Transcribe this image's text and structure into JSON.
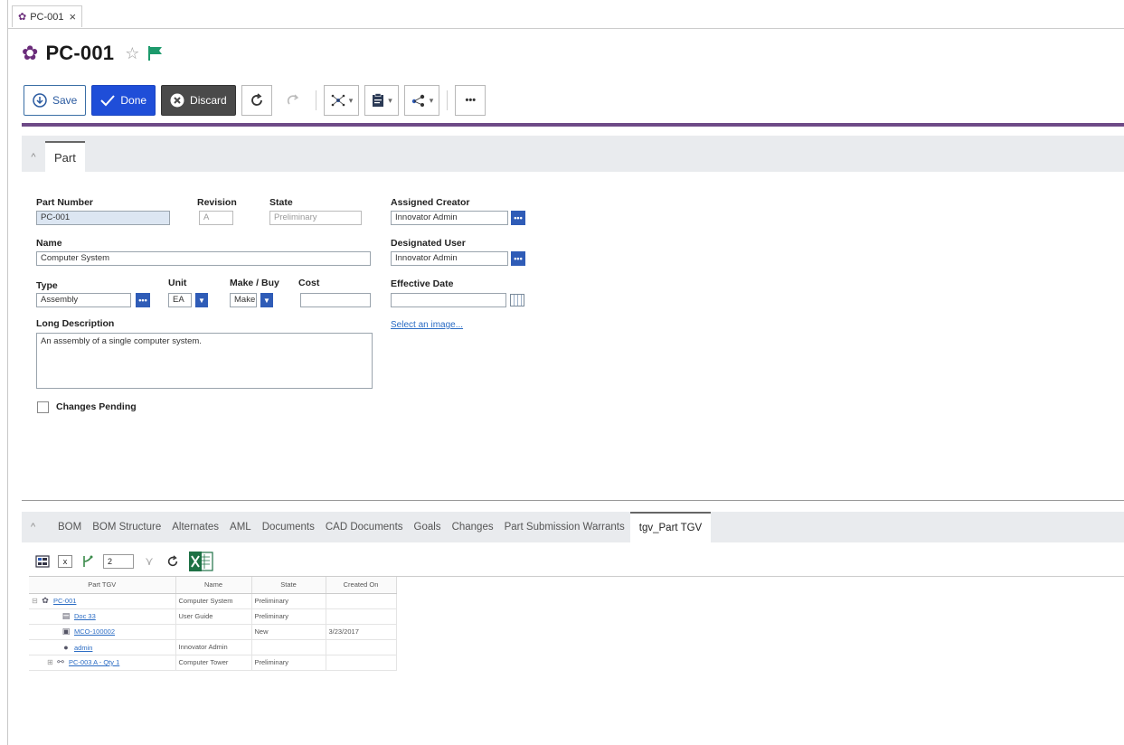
{
  "tab": {
    "label": "PC-001",
    "close": "×"
  },
  "header": {
    "title": "PC-001",
    "star": "☆"
  },
  "toolbar": {
    "save": "Save",
    "done": "Done",
    "discard": "Discard",
    "more": "•••"
  },
  "section": {
    "toggle": "^",
    "tab_label": "Part"
  },
  "form": {
    "part_number": {
      "label": "Part Number",
      "value": "PC-001"
    },
    "revision": {
      "label": "Revision",
      "value": "A"
    },
    "state": {
      "label": "State",
      "value": "Preliminary"
    },
    "assigned_creator": {
      "label": "Assigned Creator",
      "value": "Innovator Admin"
    },
    "name": {
      "label": "Name",
      "value": "Computer System"
    },
    "designated_user": {
      "label": "Designated User",
      "value": "Innovator Admin"
    },
    "type": {
      "label": "Type",
      "value": "Assembly"
    },
    "unit": {
      "label": "Unit",
      "value": "EA"
    },
    "make_buy": {
      "label": "Make / Buy",
      "value": "Make"
    },
    "cost": {
      "label": "Cost",
      "value": ""
    },
    "effective_date": {
      "label": "Effective Date",
      "value": ""
    },
    "long_description": {
      "label": "Long Description",
      "value": "An assembly of a single computer system."
    },
    "select_image": "Select an image...",
    "changes_pending": "Changes Pending"
  },
  "relationships": {
    "toggle": "^",
    "tabs": [
      "BOM",
      "BOM Structure",
      "Alternates",
      "AML",
      "Documents",
      "CAD Documents",
      "Goals",
      "Changes",
      "Part Submission Warrants",
      "tgv_Part TGV"
    ],
    "active": "tgv_Part TGV",
    "level_value": "2"
  },
  "grid": {
    "columns": [
      "Part TGV",
      "Name",
      "State",
      "Created On"
    ],
    "rows": [
      {
        "id": "PC-001",
        "name": "Computer System",
        "state": "Preliminary",
        "created": ""
      },
      {
        "id": "Doc 33",
        "name": "User Guide",
        "state": "Preliminary",
        "created": ""
      },
      {
        "id": "MCO-100002",
        "name": "",
        "state": "New",
        "created": "3/23/2017"
      },
      {
        "id": "admin",
        "name": "Innovator Admin",
        "state": "",
        "created": ""
      },
      {
        "id": "PC-003 A - Qty 1",
        "name": "Computer Tower",
        "state": "Preliminary",
        "created": ""
      }
    ]
  },
  "colors": {
    "accent": "#6e4a87",
    "done": "#1f4ed8",
    "discard": "#4a4a4a",
    "link": "#2b6cc4",
    "flag": "#1d9a6c"
  }
}
